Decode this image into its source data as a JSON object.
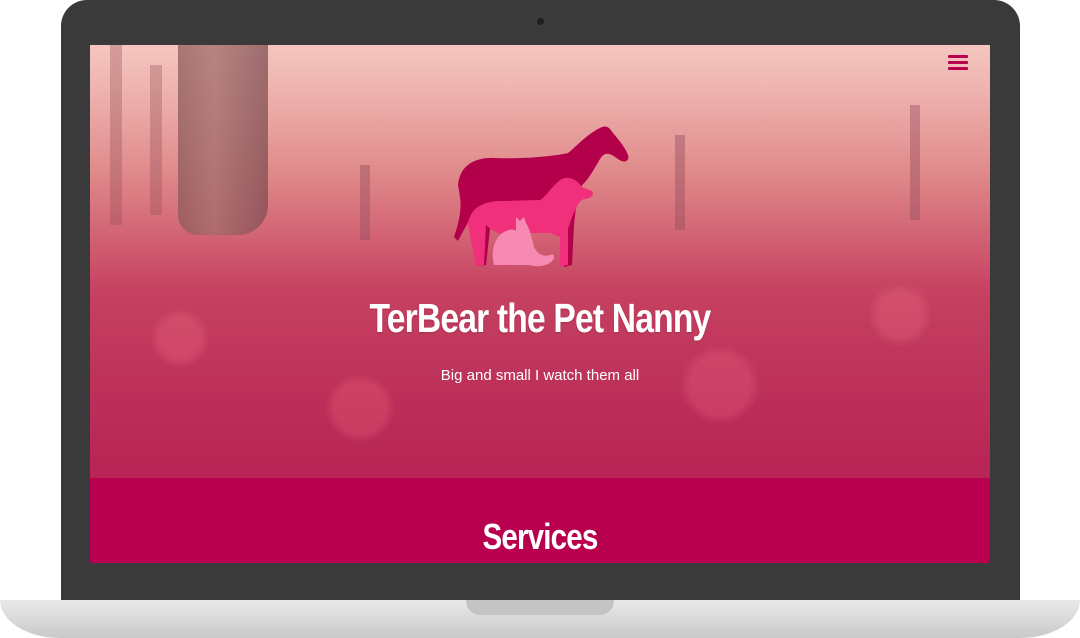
{
  "hero": {
    "title": "TerBear the Pet Nanny",
    "tagline": "Big and small I watch them all"
  },
  "sections": {
    "services_heading": "Services"
  },
  "icons": {
    "menu": "hamburger-menu-icon",
    "logo": "horse-dog-cat-silhouette-icon"
  },
  "colors": {
    "brand": "#b8004f",
    "logo_horse": "#b3004b",
    "logo_dog": "#f0307a",
    "logo_cat": "#f78ab3",
    "bezel": "#3a3a3a"
  }
}
